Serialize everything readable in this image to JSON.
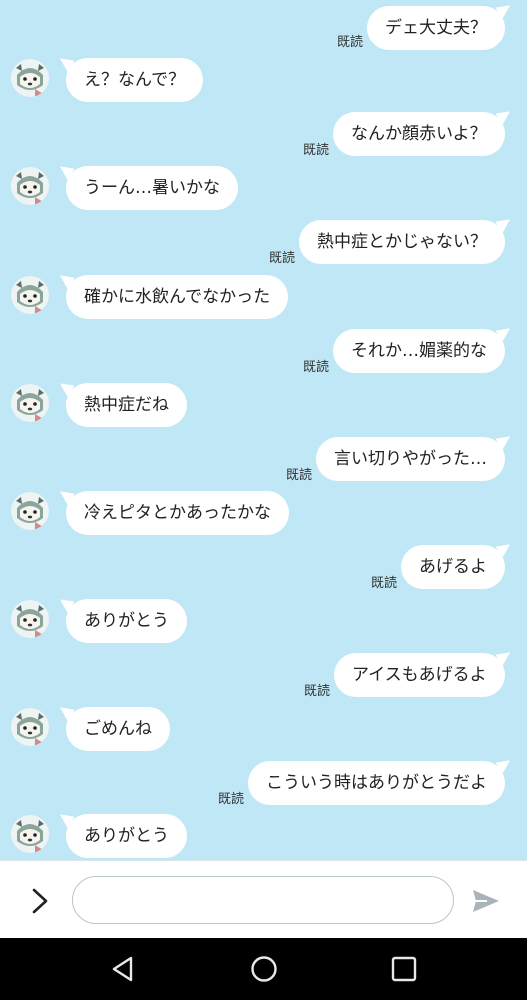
{
  "colors": {
    "chat_background": "#bfe7f5",
    "bubble": "#ffffff",
    "input_bar": "#ffffff",
    "nav_bar": "#000000",
    "send_icon": "#a9b4b8"
  },
  "read_label": "既読",
  "messages": [
    {
      "side": "out",
      "text": "デェ大丈夫？",
      "read": "既読"
    },
    {
      "side": "in",
      "text": "え？なんで？"
    },
    {
      "side": "out",
      "text": "なんか顔赤いよ？",
      "read": "既読"
    },
    {
      "side": "in",
      "text": "うーん…暑いかな"
    },
    {
      "side": "out",
      "text": "熱中症とかじゃない？",
      "read": "既読"
    },
    {
      "side": "in",
      "text": "確かに水飲んでなかった"
    },
    {
      "side": "out",
      "text": "それか…媚薬的な",
      "read": "既読"
    },
    {
      "side": "in",
      "text": "熱中症だね"
    },
    {
      "side": "out",
      "text": "言い切りやがった…",
      "read": "既読"
    },
    {
      "side": "in",
      "text": "冷えピタとかあったかな"
    },
    {
      "side": "out",
      "text": "あげるよ",
      "read": "既読"
    },
    {
      "side": "in",
      "text": "ありがとう"
    },
    {
      "side": "out",
      "text": "アイスもあげるよ",
      "read": "既読"
    },
    {
      "side": "in",
      "text": "ごめんね"
    },
    {
      "side": "out",
      "text": "こういう時はありがとうだよ",
      "read": "既読"
    },
    {
      "side": "in",
      "text": "ありがとう"
    }
  ],
  "input": {
    "value": "",
    "placeholder": "",
    "expand_icon": "chevron-right-icon",
    "send_icon": "send-icon"
  },
  "navigation": {
    "back_icon": "triangle-back-icon",
    "home_icon": "circle-home-icon",
    "recents_icon": "square-recents-icon"
  }
}
